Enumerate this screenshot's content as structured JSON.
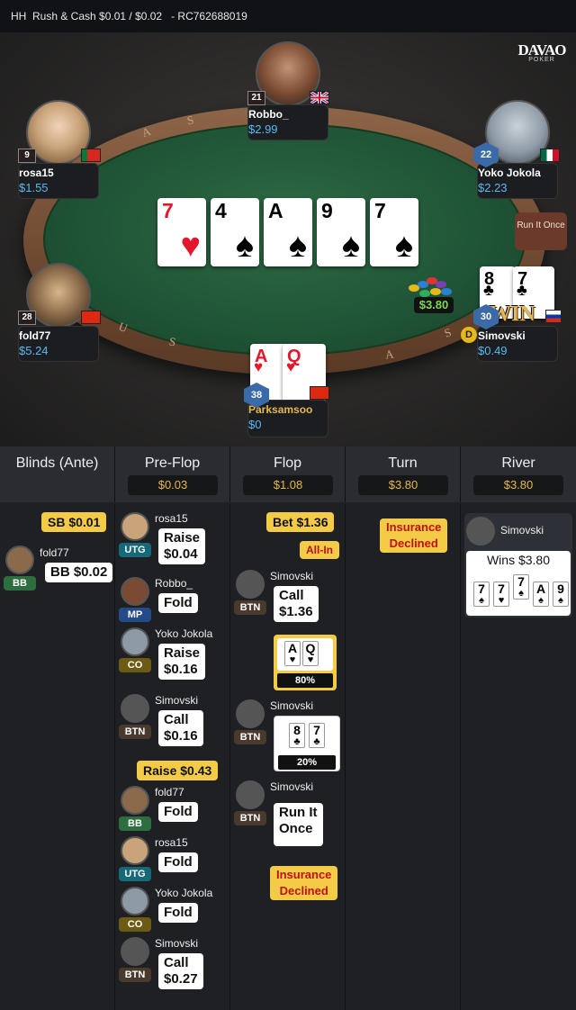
{
  "header": {
    "title": "HH  Rush & Cash $0.01 / $0.02   - RC762688019"
  },
  "logo": {
    "brand": "DAVAO",
    "sub": "POKER"
  },
  "table": {
    "rail_text": [
      "A",
      "S",
      "U",
      "S",
      "A",
      "S"
    ],
    "board": [
      {
        "rank": "7",
        "suit": "♥",
        "color": "red"
      },
      {
        "rank": "4",
        "suit": "♠",
        "color": "black"
      },
      {
        "rank": "A",
        "suit": "♠",
        "color": "black"
      },
      {
        "rank": "9",
        "suit": "♠",
        "color": "black"
      },
      {
        "rank": "7",
        "suit": "♠",
        "color": "black"
      }
    ],
    "pot": "$3.80",
    "run_it_once": "Run It Once",
    "dealer": "D",
    "win_label": "WIN"
  },
  "players": {
    "robbo": {
      "name": "Robbo_",
      "stack": "$2.99",
      "level": "21"
    },
    "rosa": {
      "name": "rosa15",
      "stack": "$1.55",
      "level": "9"
    },
    "yoko": {
      "name": "Yoko Jokola",
      "stack": "$2.23",
      "level": "22"
    },
    "fold": {
      "name": "fold77",
      "stack": "$5.24",
      "level": "28"
    },
    "simovski": {
      "name": "Simovski",
      "stack": "$0.49",
      "level": "30",
      "cards": [
        {
          "rank": "8",
          "suit": "♣"
        },
        {
          "rank": "7",
          "suit": "♣"
        }
      ]
    },
    "park": {
      "name": "Parksamsoo",
      "stack": "$0",
      "level": "38",
      "cards": [
        {
          "rank": "A",
          "suit": "♥"
        },
        {
          "rank": "Q",
          "suit": "♥"
        }
      ]
    }
  },
  "history": {
    "columns": [
      {
        "title": "Blinds (Ante)",
        "pot": ""
      },
      {
        "title": "Pre-Flop",
        "pot": "$0.03"
      },
      {
        "title": "Flop",
        "pot": "$1.08"
      },
      {
        "title": "Turn",
        "pot": "$3.80"
      },
      {
        "title": "River",
        "pot": "$3.80"
      }
    ],
    "blinds": {
      "sb": "SB $0.01",
      "bb_name": "fold77",
      "bb_pos": "BB",
      "bb": "BB $0.02"
    },
    "preflop": [
      {
        "name": "rosa15",
        "pos": "UTG",
        "action": "Raise\n$0.04"
      },
      {
        "name": "Robbo_",
        "pos": "MP",
        "action": "Fold"
      },
      {
        "name": "Yoko Jokola",
        "pos": "CO",
        "action": "Raise\n$0.16"
      },
      {
        "name": "Simovski",
        "pos": "BTN",
        "action": "Call\n$0.16"
      },
      {
        "name": "fold77",
        "pos": "BB",
        "action": "Fold"
      },
      {
        "name": "rosa15",
        "pos": "UTG",
        "action": "Fold"
      },
      {
        "name": "Yoko Jokola",
        "pos": "CO",
        "action": "Fold"
      },
      {
        "name": "Simovski",
        "pos": "BTN",
        "action": "Call\n$0.27"
      }
    ],
    "preflop_raise": "Raise $0.43",
    "flop": {
      "bet": "Bet $1.36",
      "allin": "All-In",
      "call_name": "Simovski",
      "call_pos": "BTN",
      "call": "Call\n$1.36",
      "eq1": "80%",
      "eq2_name": "Simovski",
      "eq2_pos": "BTN",
      "eq2": "20%",
      "rio_name": "Simovski",
      "rio_pos": "BTN",
      "rio": "Run It\nOnce",
      "ins": "Insurance\nDeclined"
    },
    "turn": {
      "ins": "Insurance\nDeclined"
    },
    "river": {
      "name": "Simovski",
      "wins": "Wins $3.80",
      "cards": [
        {
          "rank": "7",
          "suit": "♠"
        },
        {
          "rank": "7",
          "suit": "♥"
        },
        {
          "rank": "7",
          "suit": "♠"
        },
        {
          "rank": "A",
          "suit": "♠"
        },
        {
          "rank": "9",
          "suit": "♠"
        }
      ]
    }
  }
}
